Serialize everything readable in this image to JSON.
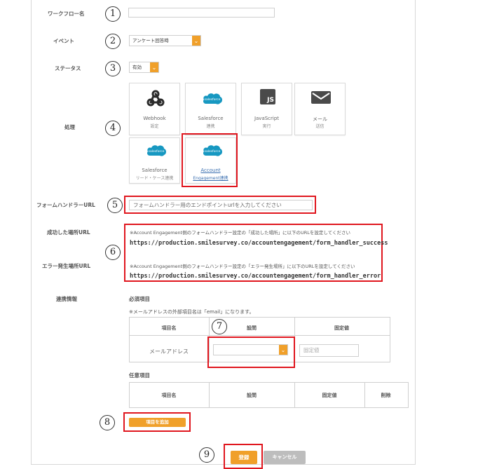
{
  "labels": {
    "workflow_name": "ワークフロー名",
    "event": "イベント",
    "status": "ステータス",
    "process": "処理",
    "form_handler_url": "フォームハンドラーURL",
    "success_url": "成功した場所URL",
    "error_url": "エラー発生場所URL",
    "link_info": "連携情報"
  },
  "markers": [
    "1",
    "2",
    "3",
    "4",
    "5",
    "6",
    "7",
    "8",
    "9"
  ],
  "workflow_name_value": "",
  "event_select": "アンケート回答時",
  "status_select": "有効",
  "process_tiles": [
    {
      "icon": "webhook-icon",
      "title": "Webhook",
      "sub": "設定"
    },
    {
      "icon": "salesforce-icon",
      "title": "Salesforce",
      "sub": "連携"
    },
    {
      "icon": "javascript-icon",
      "title": "JavaScript",
      "sub": "実行",
      "badge": "JS"
    },
    {
      "icon": "mail-icon",
      "title": "メール",
      "sub": "送信"
    },
    {
      "icon": "salesforce-icon",
      "title": "Salesforce",
      "sub": "リード・ケース連携"
    },
    {
      "icon": "salesforce-icon",
      "title": "Account",
      "sub": "Engagement連携"
    }
  ],
  "salesforce_logo_text": "salesforce",
  "form_handler_placeholder": "フォームハンドラー用のエンドポイントurlを入力してください",
  "success_note": "※Account Engagement側のフォームハンドラー設定の「成功した場所」に以下のURLを設定してください",
  "success_url_value": "https://production.smilesurvey.co/accountengagement/form_handler_success",
  "error_note": "※Account Engagement側のフォームハンドラー設定の「エラー発生場所」に以下のURLを設定してください",
  "error_url_value": "https://production.smilesurvey.co/accountengagement/form_handler_error",
  "required_heading": "必須項目",
  "email_note": "※メールアドレスの外部項目名は「email」になります。",
  "required_table": {
    "headers": [
      "項目名",
      "設問",
      "固定値"
    ],
    "row": {
      "name": "メールアドレス",
      "question": "",
      "fixed_placeholder": "固定値"
    }
  },
  "optional_heading": "任意項目",
  "optional_table": {
    "headers": [
      "項目名",
      "設問",
      "固定値",
      "削除"
    ]
  },
  "add_item_button": "項目を追加",
  "register_button": "登録",
  "cancel_button": "キャンセル",
  "colors": {
    "accent": "#f0a02a",
    "highlight": "#e0161e",
    "salesforce": "#1798c1"
  }
}
